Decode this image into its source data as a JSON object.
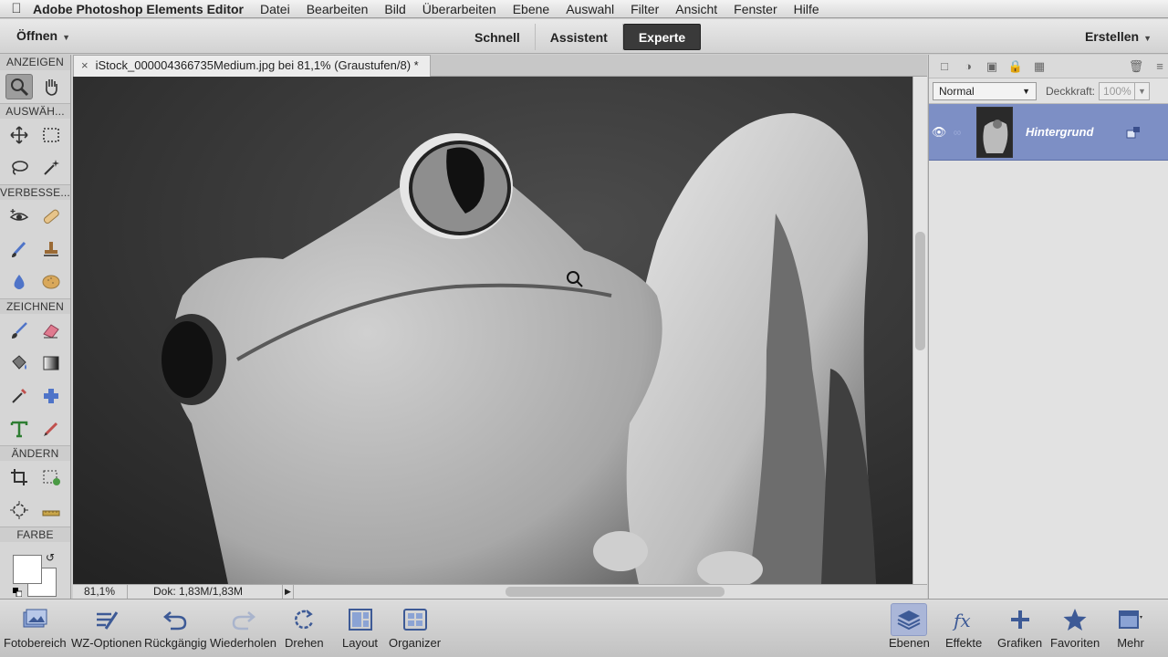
{
  "menubar": {
    "app_name": "Adobe Photoshop Elements Editor",
    "items": [
      "Datei",
      "Bearbeiten",
      "Bild",
      "Überarbeiten",
      "Ebene",
      "Auswahl",
      "Filter",
      "Ansicht",
      "Fenster",
      "Hilfe"
    ]
  },
  "modebar": {
    "open_label": "Öffnen",
    "modes": [
      "Schnell",
      "Assistent",
      "Experte"
    ],
    "active_mode": "Experte",
    "create_label": "Erstellen"
  },
  "toolbox": {
    "sections": {
      "view": "ANZEIGEN",
      "select": "AUSWÄH...",
      "enhance": "VERBESSE...",
      "draw": "ZEICHNEN",
      "modify": "ÄNDERN",
      "color": "FARBE"
    },
    "tools": {
      "view": [
        "zoom-icon",
        "hand-icon"
      ],
      "select1": [
        "move-icon",
        "marquee-icon"
      ],
      "select2": [
        "lasso-icon",
        "magic-wand-icon"
      ],
      "enhance1": [
        "red-eye-icon",
        "bandage-icon"
      ],
      "enhance2": [
        "smart-brush-icon",
        "clone-stamp-icon"
      ],
      "enhance3": [
        "blur-icon",
        "sponge-icon"
      ],
      "draw1": [
        "brush-icon",
        "eraser-icon"
      ],
      "draw2": [
        "paint-bucket-icon",
        "gradient-icon"
      ],
      "draw3": [
        "eyedropper-icon",
        "custom-shape-icon"
      ],
      "draw4": [
        "type-icon",
        "pencil-icon"
      ],
      "modify1": [
        "crop-icon",
        "recompose-icon"
      ],
      "modify2": [
        "content-move-icon",
        "straighten-icon"
      ]
    },
    "selected_tool": "zoom-icon",
    "foreground_color": "#ffffff",
    "background_color": "#ffffff"
  },
  "document": {
    "tab_title": "iStock_000004366735Medium.jpg bei 81,1% (Graustufen/8) *",
    "zoom": "81,1%",
    "doc_info": "Dok: 1,83M/1,83M"
  },
  "layers_panel": {
    "blend_mode": "Normal",
    "opacity_label": "Deckkraft:",
    "opacity_value": "100%",
    "layers": [
      {
        "name": "Hintergrund",
        "visible": true
      }
    ]
  },
  "taskbar": {
    "left": [
      {
        "label": "Fotobereich",
        "icon": "photo-bin-icon"
      },
      {
        "label": "WZ-Optionen",
        "icon": "tool-options-icon"
      },
      {
        "label": "Rückgängig",
        "icon": "undo-icon"
      },
      {
        "label": "Wiederholen",
        "icon": "redo-icon"
      },
      {
        "label": "Drehen",
        "icon": "rotate-icon"
      },
      {
        "label": "Layout",
        "icon": "layout-icon"
      },
      {
        "label": "Organizer",
        "icon": "organizer-icon"
      }
    ],
    "right": [
      {
        "label": "Ebenen",
        "icon": "layers-icon"
      },
      {
        "label": "Effekte",
        "icon": "fx-icon"
      },
      {
        "label": "Grafiken",
        "icon": "plus-icon"
      },
      {
        "label": "Favoriten",
        "icon": "star-icon"
      },
      {
        "label": "Mehr",
        "icon": "more-icon"
      }
    ]
  }
}
